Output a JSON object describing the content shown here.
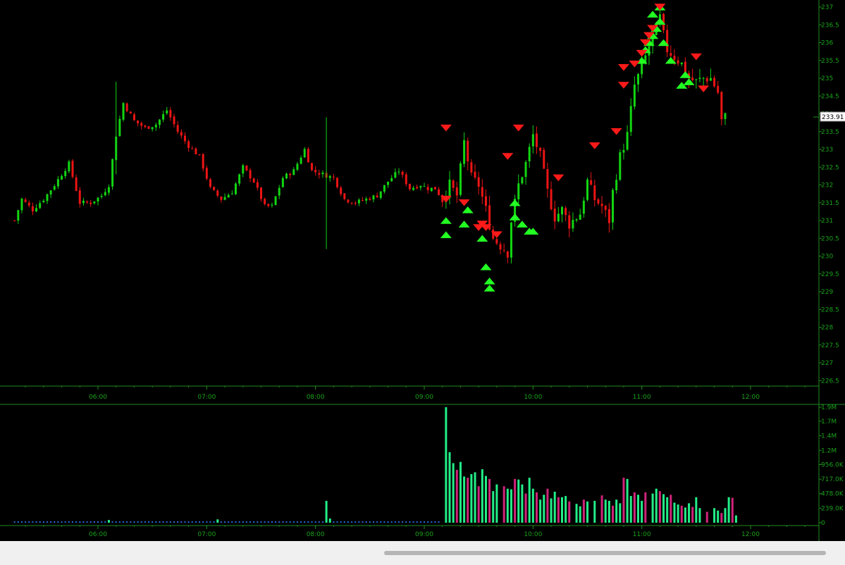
{
  "colors": {
    "background": "#000000",
    "axis": "#1f8a1f",
    "axis_label": "#1aa21a",
    "candle_up": "#12d512",
    "candle_down": "#ec1414",
    "signal_up": "#22ff22",
    "signal_down": "#ff1a1a",
    "volume_up": "#22ee88",
    "volume_down": "#d0247a",
    "price_box_bg": "#ffffff",
    "price_box_fg": "#000000",
    "scrollbar_bg": "#f0f0f0",
    "scrollbar_thumb": "#b5b5b5"
  },
  "scrollbar": {
    "label": "horizontal-scrollbar"
  },
  "chart_data": [
    {
      "type": "candlestick",
      "panel": "price",
      "title": "",
      "xlabel": "",
      "ylabel": "",
      "ylim": [
        226.25,
        237.2
      ],
      "y_ticks": [
        "237",
        "236.5",
        "236",
        "235.5",
        "235",
        "234.5",
        "234",
        "233.5",
        "233",
        "232.5",
        "232",
        "231.5",
        "231",
        "230.5",
        "230",
        "229.5",
        "229",
        "228.5",
        "228",
        "227.5",
        "227",
        "226.5"
      ],
      "x_ticks": [
        "06:00",
        "07:00",
        "08:00",
        "09:00",
        "10:00",
        "11:00",
        "12:00"
      ],
      "last_price_label": "233.91",
      "last_price_value": 233.91,
      "x_range_minutes": [
        314,
        766
      ],
      "bar_minutes": 2,
      "anchor_closes": [
        [
          314,
          231.0
        ],
        [
          318,
          231.6
        ],
        [
          324,
          231.3
        ],
        [
          330,
          231.6
        ],
        [
          336,
          232.0
        ],
        [
          344,
          232.6
        ],
        [
          350,
          231.5
        ],
        [
          356,
          231.5
        ],
        [
          362,
          231.7
        ],
        [
          366,
          232.0
        ],
        [
          370,
          233.4
        ],
        [
          374,
          234.3
        ],
        [
          380,
          233.8
        ],
        [
          386,
          233.6
        ],
        [
          392,
          233.7
        ],
        [
          398,
          234.1
        ],
        [
          404,
          233.5
        ],
        [
          410,
          233.1
        ],
        [
          416,
          232.8
        ],
        [
          422,
          231.9
        ],
        [
          428,
          231.6
        ],
        [
          434,
          231.8
        ],
        [
          440,
          232.5
        ],
        [
          446,
          232.1
        ],
        [
          452,
          231.4
        ],
        [
          456,
          231.4
        ],
        [
          462,
          232.2
        ],
        [
          468,
          232.4
        ],
        [
          474,
          233.0
        ],
        [
          478,
          232.4
        ],
        [
          484,
          232.3
        ],
        [
          490,
          232.2
        ],
        [
          496,
          231.6
        ],
        [
          502,
          231.5
        ],
        [
          508,
          231.6
        ],
        [
          514,
          231.7
        ],
        [
          520,
          232.1
        ],
        [
          526,
          232.4
        ],
        [
          532,
          231.9
        ],
        [
          538,
          232.0
        ],
        [
          542,
          231.9
        ],
        [
          546,
          231.9
        ],
        [
          550,
          231.6
        ],
        [
          554,
          232.0
        ],
        [
          558,
          231.7
        ],
        [
          562,
          233.2
        ],
        [
          566,
          232.2
        ],
        [
          570,
          232.0
        ],
        [
          574,
          231.3
        ],
        [
          578,
          230.5
        ],
        [
          582,
          230.3
        ],
        [
          586,
          230.1
        ],
        [
          588,
          231.0
        ],
        [
          592,
          232.0
        ],
        [
          596,
          232.6
        ],
        [
          600,
          233.4
        ],
        [
          604,
          232.8
        ],
        [
          608,
          231.8
        ],
        [
          612,
          231.1
        ],
        [
          616,
          231.3
        ],
        [
          620,
          230.9
        ],
        [
          626,
          231.2
        ],
        [
          630,
          232.1
        ],
        [
          634,
          231.6
        ],
        [
          638,
          231.4
        ],
        [
          642,
          231.0
        ],
        [
          644,
          231.8
        ],
        [
          648,
          232.8
        ],
        [
          652,
          233.4
        ],
        [
          656,
          234.8
        ],
        [
          660,
          235.3
        ],
        [
          664,
          235.9
        ],
        [
          668,
          236.4
        ],
        [
          670,
          236.7
        ],
        [
          672,
          236.2
        ],
        [
          674,
          235.8
        ],
        [
          678,
          235.6
        ],
        [
          682,
          235.4
        ],
        [
          686,
          235.0
        ],
        [
          690,
          234.9
        ],
        [
          694,
          235.0
        ],
        [
          698,
          235.0
        ],
        [
          702,
          234.6
        ],
        [
          704,
          233.8
        ],
        [
          706,
          233.91
        ]
      ],
      "candles_note": "OHLC bars generated from anchor_closes",
      "signals_up": [
        [
          552,
          231.0
        ],
        [
          552,
          230.6
        ],
        [
          562,
          230.9
        ],
        [
          564,
          231.3
        ],
        [
          572,
          230.5
        ],
        [
          574,
          229.7
        ],
        [
          576,
          229.3
        ],
        [
          576,
          229.1
        ],
        [
          590,
          231.5
        ],
        [
          590,
          231.1
        ],
        [
          594,
          230.9
        ],
        [
          598,
          230.7
        ],
        [
          600,
          230.7
        ],
        [
          660,
          235.5
        ],
        [
          662,
          235.8
        ],
        [
          664,
          236.0
        ],
        [
          666,
          236.2
        ],
        [
          666,
          236.8
        ],
        [
          668,
          236.4
        ],
        [
          670,
          236.6
        ],
        [
          670,
          237.0
        ],
        [
          672,
          236.0
        ],
        [
          676,
          235.5
        ],
        [
          682,
          234.8
        ],
        [
          684,
          235.1
        ],
        [
          686,
          234.9
        ]
      ],
      "signals_down": [
        [
          552,
          231.6
        ],
        [
          552,
          233.6
        ],
        [
          562,
          231.5
        ],
        [
          570,
          230.8
        ],
        [
          572,
          230.9
        ],
        [
          574,
          230.8
        ],
        [
          580,
          230.6
        ],
        [
          586,
          232.8
        ],
        [
          592,
          233.6
        ],
        [
          614,
          232.2
        ],
        [
          634,
          233.1
        ],
        [
          646,
          233.5
        ],
        [
          650,
          234.8
        ],
        [
          650,
          235.3
        ],
        [
          656,
          235.4
        ],
        [
          660,
          235.7
        ],
        [
          662,
          236.0
        ],
        [
          664,
          236.2
        ],
        [
          666,
          236.4
        ],
        [
          670,
          237.0
        ],
        [
          690,
          235.6
        ],
        [
          694,
          234.7
        ]
      ]
    },
    {
      "type": "bar",
      "panel": "volume",
      "title": "",
      "xlabel": "",
      "ylabel": "",
      "ylim": [
        0,
        1900000
      ],
      "y_ticks": [
        "1.9M",
        "1.7M",
        "1.4M",
        "1.2M",
        "956.0K",
        "717.0K",
        "478.0K",
        "239.0K",
        "0"
      ],
      "x_ticks": [
        "06:00",
        "07:00",
        "08:00",
        "09:00",
        "10:00",
        "11:00",
        "12:00"
      ],
      "spikes": [
        [
          366,
          45000
        ],
        [
          426,
          55000
        ],
        [
          486,
          360000
        ],
        [
          488,
          70000
        ],
        [
          552,
          1900000
        ],
        [
          554,
          1160000
        ],
        [
          556,
          980000
        ],
        [
          558,
          870000
        ],
        [
          560,
          1000000
        ],
        [
          562,
          760000
        ],
        [
          564,
          740000
        ],
        [
          566,
          800000
        ],
        [
          568,
          830000
        ],
        [
          570,
          600000
        ],
        [
          572,
          880000
        ],
        [
          574,
          770000
        ],
        [
          576,
          720000
        ],
        [
          578,
          520000
        ],
        [
          580,
          630000
        ],
        [
          584,
          600000
        ],
        [
          586,
          560000
        ],
        [
          588,
          550000
        ],
        [
          590,
          720000
        ],
        [
          592,
          710000
        ],
        [
          594,
          630000
        ],
        [
          596,
          480000
        ],
        [
          598,
          740000
        ],
        [
          600,
          560000
        ],
        [
          602,
          500000
        ],
        [
          604,
          380000
        ],
        [
          606,
          460000
        ],
        [
          608,
          560000
        ],
        [
          610,
          400000
        ],
        [
          612,
          510000
        ],
        [
          614,
          420000
        ],
        [
          616,
          420000
        ],
        [
          618,
          440000
        ],
        [
          620,
          350000
        ],
        [
          624,
          310000
        ],
        [
          626,
          270000
        ],
        [
          628,
          380000
        ],
        [
          630,
          350000
        ],
        [
          634,
          360000
        ],
        [
          638,
          450000
        ],
        [
          640,
          380000
        ],
        [
          642,
          360000
        ],
        [
          644,
          280000
        ],
        [
          646,
          380000
        ],
        [
          648,
          320000
        ],
        [
          650,
          740000
        ],
        [
          652,
          720000
        ],
        [
          654,
          440000
        ],
        [
          656,
          500000
        ],
        [
          658,
          460000
        ],
        [
          660,
          360000
        ],
        [
          662,
          500000
        ],
        [
          666,
          480000
        ],
        [
          668,
          560000
        ],
        [
          670,
          520000
        ],
        [
          672,
          470000
        ],
        [
          674,
          420000
        ],
        [
          676,
          460000
        ],
        [
          678,
          330000
        ],
        [
          680,
          300000
        ],
        [
          682,
          280000
        ],
        [
          684,
          250000
        ],
        [
          686,
          320000
        ],
        [
          688,
          260000
        ],
        [
          690,
          420000
        ],
        [
          692,
          240000
        ],
        [
          696,
          180000
        ],
        [
          700,
          240000
        ],
        [
          702,
          200000
        ],
        [
          704,
          160000
        ],
        [
          706,
          240000
        ],
        [
          708,
          420000
        ],
        [
          710,
          410000
        ],
        [
          712,
          120000
        ]
      ]
    }
  ]
}
